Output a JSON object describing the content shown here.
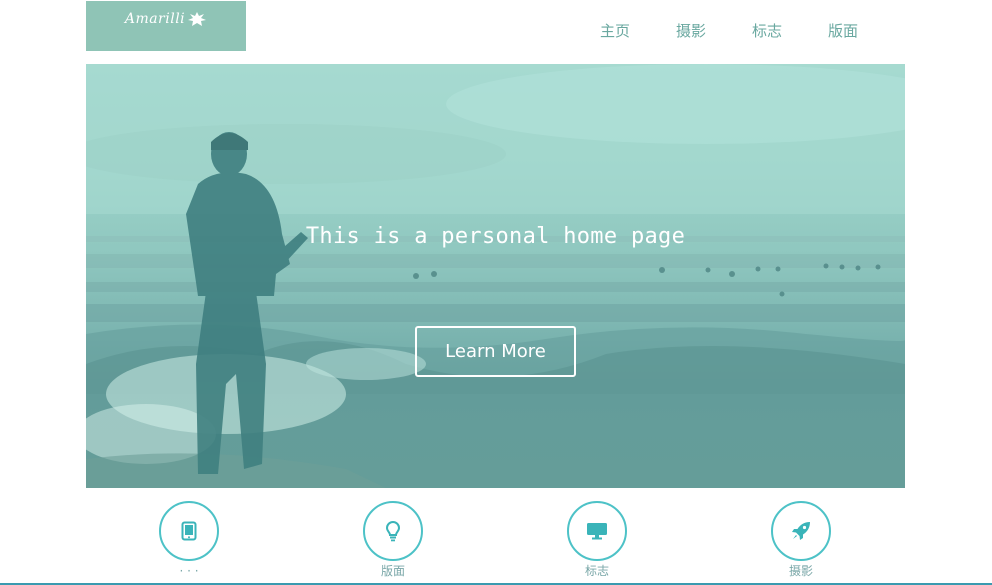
{
  "header": {
    "logo_text": "Amarilli",
    "nav": [
      "主页",
      "摄影",
      "标志",
      "版面"
    ]
  },
  "hero": {
    "title": "This is a personal home page",
    "button_label": "Learn More"
  },
  "features": [
    {
      "icon": "tablet-icon",
      "label": "· · ·"
    },
    {
      "icon": "lightbulb-icon",
      "label": "版面"
    },
    {
      "icon": "monitor-icon",
      "label": "标志"
    },
    {
      "icon": "rocket-icon",
      "label": "摄影"
    }
  ],
  "colors": {
    "accent": "#4dc2c7",
    "logo_bg": "#8fc4b6",
    "nav_text": "#6aa8a0",
    "label_text": "#7aa7a8"
  }
}
